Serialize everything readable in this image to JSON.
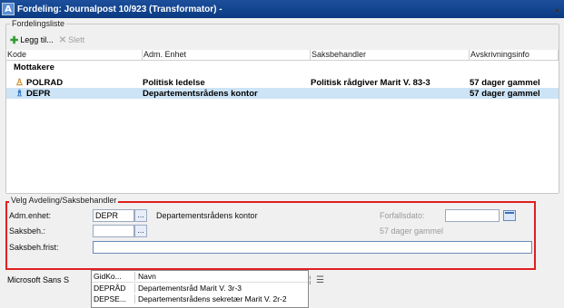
{
  "window": {
    "title": "Fordeling: Journalpost 10/923 (Transformator) -",
    "app_icon_glyph": "A"
  },
  "fordelingsliste": {
    "legend": "Fordelingsliste",
    "toolbar": {
      "add_label": "Legg til...",
      "delete_label": "Slett"
    },
    "columns": [
      "Kode",
      "Adm. Enhet",
      "Saksbehandler",
      "Avskrivningsinfo"
    ],
    "group_label": "Mottakere",
    "rows": [
      {
        "kode": "POLRAD",
        "adm_enhet": "Politisk ledelse",
        "saksbehandler": "Politisk rådgiver Marit V. 83-3",
        "avskrivning": "57 dager gammel",
        "icon": "person-icon"
      },
      {
        "kode": "DEPR",
        "adm_enhet": "Departementsrådens kontor",
        "saksbehandler": "",
        "avskrivning": "57 dager gammel",
        "icon": "department-icon"
      }
    ]
  },
  "velg": {
    "legend": "Velg Avdeling/Saksbehandler",
    "adm_enhet_label": "Adm.enhet:",
    "adm_enhet_value": "DEPR",
    "adm_enhet_name": "Departementsrådens kontor",
    "saksbeh_label": "Saksbeh.:",
    "saksbeh_value": "",
    "frist_label": "Saksbeh.frist:",
    "frist_value": "",
    "forfallsdato_label": "Forfallsdato:",
    "forfallsdato_value": "",
    "age_text": "57 dager gammel",
    "dots": "..."
  },
  "bottombar": {
    "font_label": "Microsoft Sans S"
  },
  "dropdown": {
    "columns": [
      "GidKo...",
      "Navn"
    ],
    "rows": [
      {
        "code": "DEPRÅD",
        "name": "Departementsråd Marit V. 3r-3"
      },
      {
        "code": "DEPSE...",
        "name": "Departementsrådens sekretær Marit V. 2r-2"
      }
    ]
  }
}
